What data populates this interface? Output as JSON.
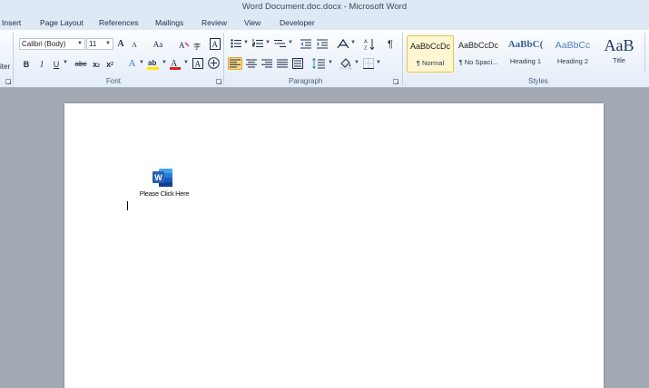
{
  "window": {
    "title": "Word Document.doc.docx - Microsoft Word"
  },
  "ribbon_tabs": [
    "Insert",
    "Page Layout",
    "References",
    "Mailings",
    "Review",
    "View",
    "Developer"
  ],
  "clipboard": {
    "partial_label": "iter"
  },
  "font": {
    "name": "Calibri (Body)",
    "size": "11",
    "group_label": "Font",
    "glyphs": {
      "grow": "A",
      "shrink": "A",
      "case": "Aa",
      "bold": "B",
      "italic": "I",
      "underline": "U",
      "strike": "abc",
      "subscript": "x",
      "superscript": "x",
      "effects": "A",
      "color": "A"
    }
  },
  "paragraph": {
    "group_label": "Paragraph",
    "glyphs": {
      "pilcrow": "¶"
    }
  },
  "styles": {
    "group_label": "Styles",
    "items": [
      {
        "sample": "AaBbCcDc",
        "name": "¶ Normal",
        "selected": true
      },
      {
        "sample": "AaBbCcDc",
        "name": "¶ No Spaci...",
        "selected": false
      },
      {
        "sample": "AaBbC(",
        "name": "Heading 1",
        "selected": false
      },
      {
        "sample": "AaBbCc",
        "name": "Heading 2",
        "selected": false
      },
      {
        "sample": "AaB",
        "name": "Title",
        "selected": false
      }
    ]
  },
  "document": {
    "embedded_object": {
      "label": "Please Click Here",
      "icon": "word-app-icon",
      "icon_letter": "W"
    }
  },
  "colors": {
    "highlight": "#ffe600",
    "font_color": "#e02020",
    "word_blue": "#2b5fb6",
    "selected_button": "#fbd884"
  }
}
